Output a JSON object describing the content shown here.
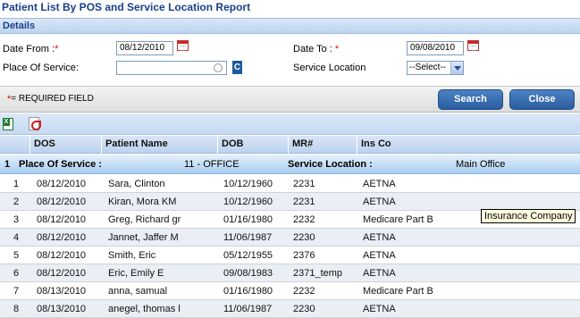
{
  "title": "Patient List By POS and Service Location Report",
  "section": "Details",
  "form": {
    "date_from_label": "Date From :",
    "date_from_value": "08/12/2010",
    "date_to_label": "Date To :",
    "date_to_value": "09/08/2010",
    "pos_label": "Place Of Service:",
    "pos_value": "",
    "clear_label": "C",
    "service_location_label": "Service Location",
    "service_location_value": "--Select--",
    "required_star": "*"
  },
  "actions": {
    "required_note": "= REQUIRED FIELD",
    "search_label": "Search",
    "close_label": "Close"
  },
  "toolbar": {
    "export_icons": [
      "excel-icon",
      "pdf-icon"
    ]
  },
  "table": {
    "columns": [
      "DOS",
      "Patient Name",
      "DOB",
      "MR#",
      "Ins Co"
    ],
    "group": {
      "number": "1",
      "pos_label": "Place Of Service :",
      "pos_value": "11 - OFFICE",
      "location_label": "Service Location :",
      "location_value": "Main Office"
    },
    "rows": [
      {
        "n": "1",
        "dos": "08/12/2010",
        "name": "Sara, Clinton",
        "dob": "10/12/1960",
        "mr": "2231",
        "ins": "AETNA"
      },
      {
        "n": "2",
        "dos": "08/12/2010",
        "name": "Kiran, Mora KM",
        "dob": "10/12/1960",
        "mr": "2231",
        "ins": "AETNA"
      },
      {
        "n": "3",
        "dos": "08/12/2010",
        "name": "Greg, Richard gr",
        "dob": "01/16/1980",
        "mr": "2232",
        "ins": "Medicare Part B"
      },
      {
        "n": "4",
        "dos": "08/12/2010",
        "name": "Jannet, Jaffer M",
        "dob": "11/06/1987",
        "mr": "2230",
        "ins": "AETNA"
      },
      {
        "n": "5",
        "dos": "08/12/2010",
        "name": "Smith, Eric",
        "dob": "05/12/1955",
        "mr": "2376",
        "ins": "AETNA"
      },
      {
        "n": "6",
        "dos": "08/12/2010",
        "name": "Eric, Emily E",
        "dob": "09/08/1983",
        "mr": "2371_temp",
        "ins": "AETNA"
      },
      {
        "n": "7",
        "dos": "08/13/2010",
        "name": "anna, samual",
        "dob": "01/16/1980",
        "mr": "2232",
        "ins": "Medicare Part B"
      },
      {
        "n": "8",
        "dos": "08/13/2010",
        "name": "anegel, thomas l",
        "dob": "11/06/1987",
        "mr": "2230",
        "ins": "AETNA"
      }
    ]
  },
  "tooltip": "Insurance Company"
}
